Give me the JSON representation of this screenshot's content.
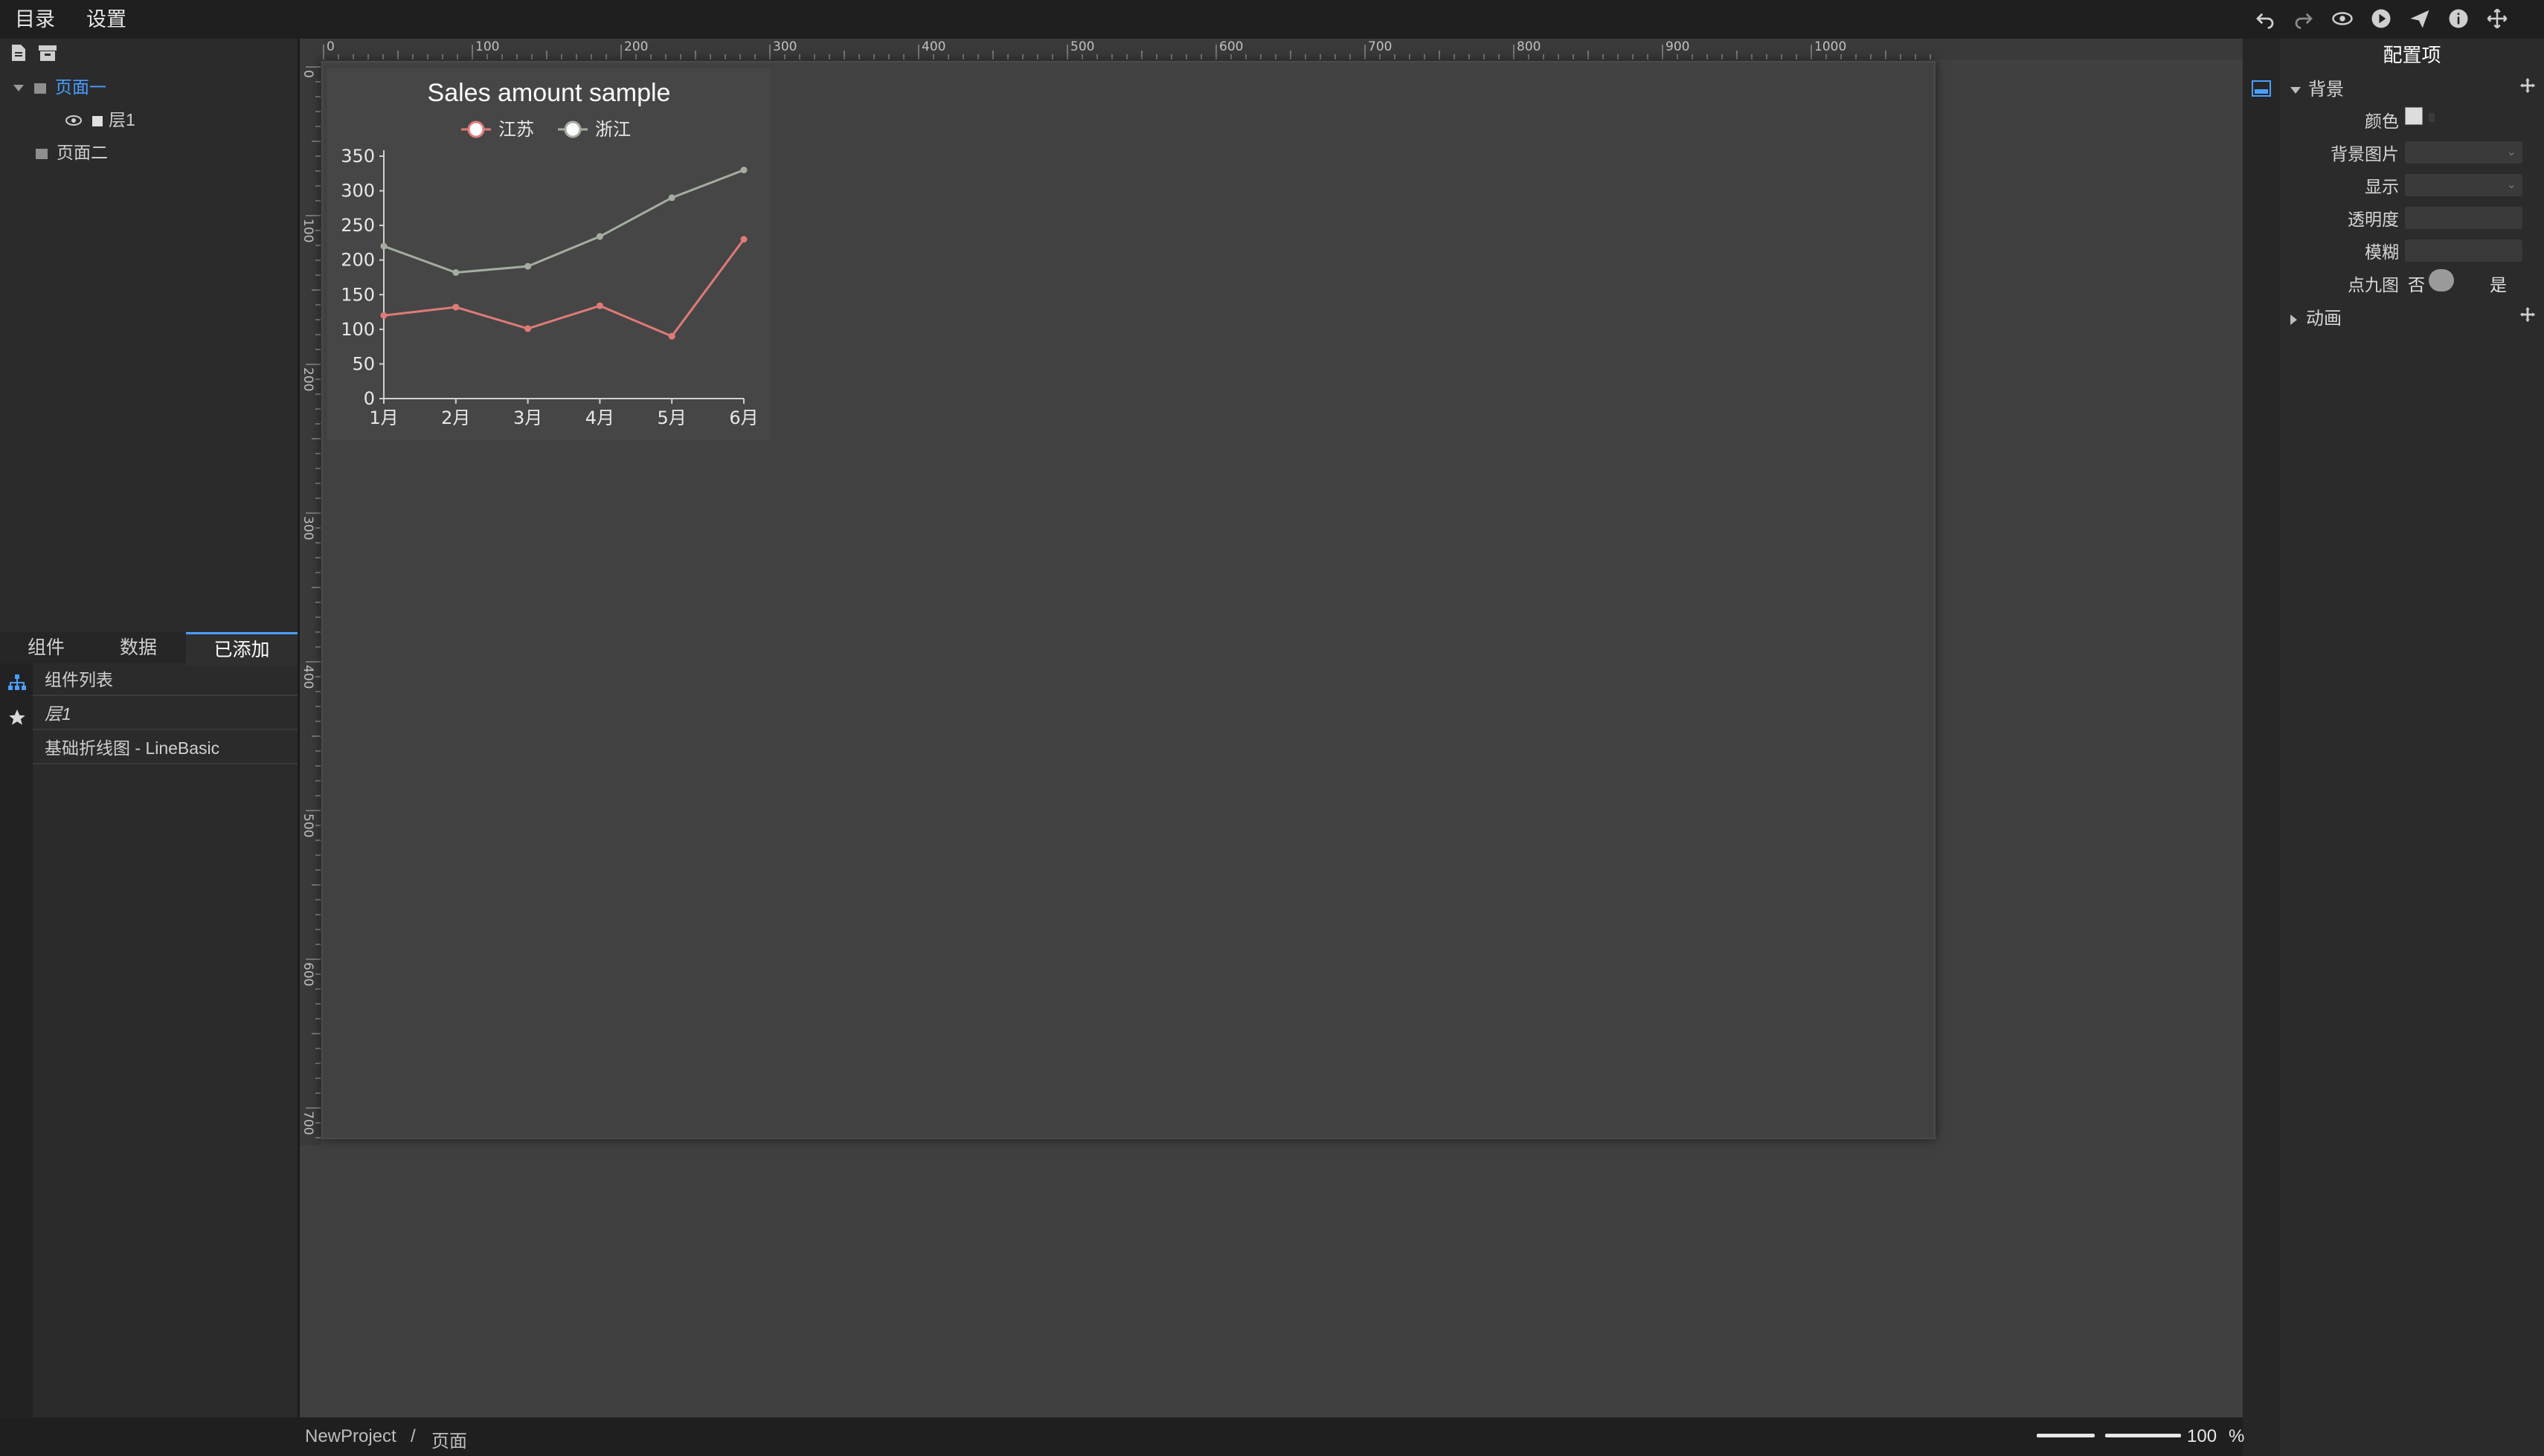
{
  "menu": {
    "catalog": "目录",
    "settings": "设置"
  },
  "toolbar_icons": [
    "undo-icon",
    "redo-icon",
    "eye-icon",
    "play-icon",
    "send-icon",
    "info-icon",
    "move-icon"
  ],
  "pages_tree": {
    "page1": "页面一",
    "layer1": "层1",
    "page2": "页面二"
  },
  "tabs": {
    "components": "组件",
    "data": "数据",
    "added": "已添加"
  },
  "added_list": {
    "header": "组件列表",
    "layer": "层1",
    "item": "基础折线图 - LineBasic"
  },
  "ruler": {
    "top": [
      "0",
      "100",
      "200",
      "300",
      "400",
      "500",
      "600",
      "700",
      "800",
      "900",
      "1000"
    ],
    "left": [
      "0",
      "100",
      "200",
      "300",
      "400",
      "500",
      "600",
      "700"
    ]
  },
  "config": {
    "title": "配置项",
    "background_section": "背景",
    "color": "颜色",
    "bg_image": "背景图片",
    "display": "显示",
    "opacity": "透明度",
    "blur": "模糊",
    "nine_patch": "点九图",
    "no": "否",
    "yes": "是",
    "animation_section": "动画"
  },
  "status": {
    "project": "NewProject",
    "separator": "/",
    "page": "页面",
    "zoom": "100",
    "zoom_unit": "%"
  },
  "chart_data": {
    "type": "line",
    "title": "Sales amount sample",
    "categories": [
      "1月",
      "2月",
      "3月",
      "4月",
      "5月",
      "6月"
    ],
    "series": [
      {
        "name": "江苏",
        "values": [
          120,
          132,
          101,
          134,
          90,
          230
        ],
        "color": "#e07a78"
      },
      {
        "name": "浙江",
        "values": [
          220,
          182,
          191,
          234,
          290,
          330
        ],
        "color": "#a4aea0"
      }
    ],
    "ylim": [
      0,
      350
    ],
    "yticks": [
      "0",
      "50",
      "100",
      "150",
      "200",
      "250",
      "300",
      "350"
    ],
    "legend": "top-center",
    "grid": false
  }
}
